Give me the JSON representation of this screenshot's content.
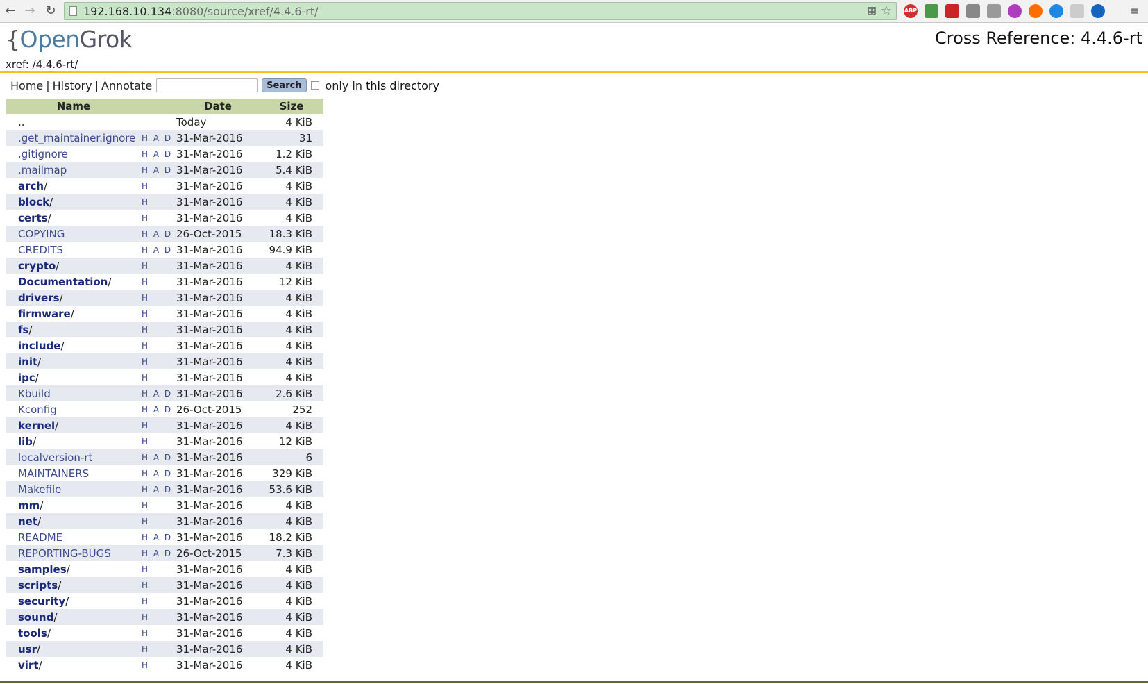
{
  "browser": {
    "url_host": "192.168.10.134",
    "url_rest": ":8080/source/xref/4.4.6-rt/"
  },
  "header": {
    "logo_brace": "{",
    "logo_open": "Open",
    "logo_grok": "Grok",
    "title": "Cross Reference: 4.4.6-rt",
    "breadcrumb": "xref: /4.4.6-rt/"
  },
  "toolbar": {
    "home": "Home",
    "history": "History",
    "annotate": "Annotate",
    "separator": "|",
    "search_value": "",
    "search_button": "Search",
    "only_in": "only in",
    "this_directory": "this directory"
  },
  "table": {
    "headers": {
      "name": "Name",
      "date": "Date",
      "size": "Size"
    },
    "rows": [
      {
        "name": "..",
        "type": "parent",
        "had": "",
        "date": "Today",
        "size": "4 KiB"
      },
      {
        "name": ".get_maintainer.ignore",
        "type": "file",
        "had": "H A D",
        "date": "31-Mar-2016",
        "size": "31"
      },
      {
        "name": ".gitignore",
        "type": "file",
        "had": "H A D",
        "date": "31-Mar-2016",
        "size": "1.2 KiB"
      },
      {
        "name": ".mailmap",
        "type": "file",
        "had": "H A D",
        "date": "31-Mar-2016",
        "size": "5.4 KiB"
      },
      {
        "name": "arch",
        "type": "dir",
        "had": "H",
        "date": "31-Mar-2016",
        "size": "4 KiB"
      },
      {
        "name": "block",
        "type": "dir",
        "had": "H",
        "date": "31-Mar-2016",
        "size": "4 KiB"
      },
      {
        "name": "certs",
        "type": "dir",
        "had": "H",
        "date": "31-Mar-2016",
        "size": "4 KiB"
      },
      {
        "name": "COPYING",
        "type": "file",
        "had": "H A D",
        "date": "26-Oct-2015",
        "size": "18.3 KiB"
      },
      {
        "name": "CREDITS",
        "type": "file",
        "had": "H A D",
        "date": "31-Mar-2016",
        "size": "94.9 KiB"
      },
      {
        "name": "crypto",
        "type": "dir",
        "had": "H",
        "date": "31-Mar-2016",
        "size": "4 KiB"
      },
      {
        "name": "Documentation",
        "type": "dir",
        "had": "H",
        "date": "31-Mar-2016",
        "size": "12 KiB"
      },
      {
        "name": "drivers",
        "type": "dir",
        "had": "H",
        "date": "31-Mar-2016",
        "size": "4 KiB"
      },
      {
        "name": "firmware",
        "type": "dir",
        "had": "H",
        "date": "31-Mar-2016",
        "size": "4 KiB"
      },
      {
        "name": "fs",
        "type": "dir",
        "had": "H",
        "date": "31-Mar-2016",
        "size": "4 KiB"
      },
      {
        "name": "include",
        "type": "dir",
        "had": "H",
        "date": "31-Mar-2016",
        "size": "4 KiB"
      },
      {
        "name": "init",
        "type": "dir",
        "had": "H",
        "date": "31-Mar-2016",
        "size": "4 KiB"
      },
      {
        "name": "ipc",
        "type": "dir",
        "had": "H",
        "date": "31-Mar-2016",
        "size": "4 KiB"
      },
      {
        "name": "Kbuild",
        "type": "file",
        "had": "H A D",
        "date": "31-Mar-2016",
        "size": "2.6 KiB"
      },
      {
        "name": "Kconfig",
        "type": "file",
        "had": "H A D",
        "date": "26-Oct-2015",
        "size": "252"
      },
      {
        "name": "kernel",
        "type": "dir",
        "had": "H",
        "date": "31-Mar-2016",
        "size": "4 KiB"
      },
      {
        "name": "lib",
        "type": "dir",
        "had": "H",
        "date": "31-Mar-2016",
        "size": "12 KiB"
      },
      {
        "name": "localversion-rt",
        "type": "file",
        "had": "H A D",
        "date": "31-Mar-2016",
        "size": "6"
      },
      {
        "name": "MAINTAINERS",
        "type": "file",
        "had": "H A D",
        "date": "31-Mar-2016",
        "size": "329 KiB"
      },
      {
        "name": "Makefile",
        "type": "file",
        "had": "H A D",
        "date": "31-Mar-2016",
        "size": "53.6 KiB"
      },
      {
        "name": "mm",
        "type": "dir",
        "had": "H",
        "date": "31-Mar-2016",
        "size": "4 KiB"
      },
      {
        "name": "net",
        "type": "dir",
        "had": "H",
        "date": "31-Mar-2016",
        "size": "4 KiB"
      },
      {
        "name": "README",
        "type": "file",
        "had": "H A D",
        "date": "31-Mar-2016",
        "size": "18.2 KiB"
      },
      {
        "name": "REPORTING-BUGS",
        "type": "file",
        "had": "H A D",
        "date": "26-Oct-2015",
        "size": "7.3 KiB"
      },
      {
        "name": "samples",
        "type": "dir",
        "had": "H",
        "date": "31-Mar-2016",
        "size": "4 KiB"
      },
      {
        "name": "scripts",
        "type": "dir",
        "had": "H",
        "date": "31-Mar-2016",
        "size": "4 KiB"
      },
      {
        "name": "security",
        "type": "dir",
        "had": "H",
        "date": "31-Mar-2016",
        "size": "4 KiB"
      },
      {
        "name": "sound",
        "type": "dir",
        "had": "H",
        "date": "31-Mar-2016",
        "size": "4 KiB"
      },
      {
        "name": "tools",
        "type": "dir",
        "had": "H",
        "date": "31-Mar-2016",
        "size": "4 KiB"
      },
      {
        "name": "usr",
        "type": "dir",
        "had": "H",
        "date": "31-Mar-2016",
        "size": "4 KiB"
      },
      {
        "name": "virt",
        "type": "dir",
        "had": "H",
        "date": "31-Mar-2016",
        "size": "4 KiB"
      }
    ]
  },
  "colors": {
    "header_bg": "#c9d6a8",
    "row_alt_bg": "#e7e9f1",
    "accent_bar": "#f7c21b",
    "link": "#3a4a8c"
  },
  "icons": {
    "back": "back-arrow-icon",
    "forward": "forward-arrow-icon",
    "reload": "reload-icon",
    "bookmark": "star-icon"
  }
}
